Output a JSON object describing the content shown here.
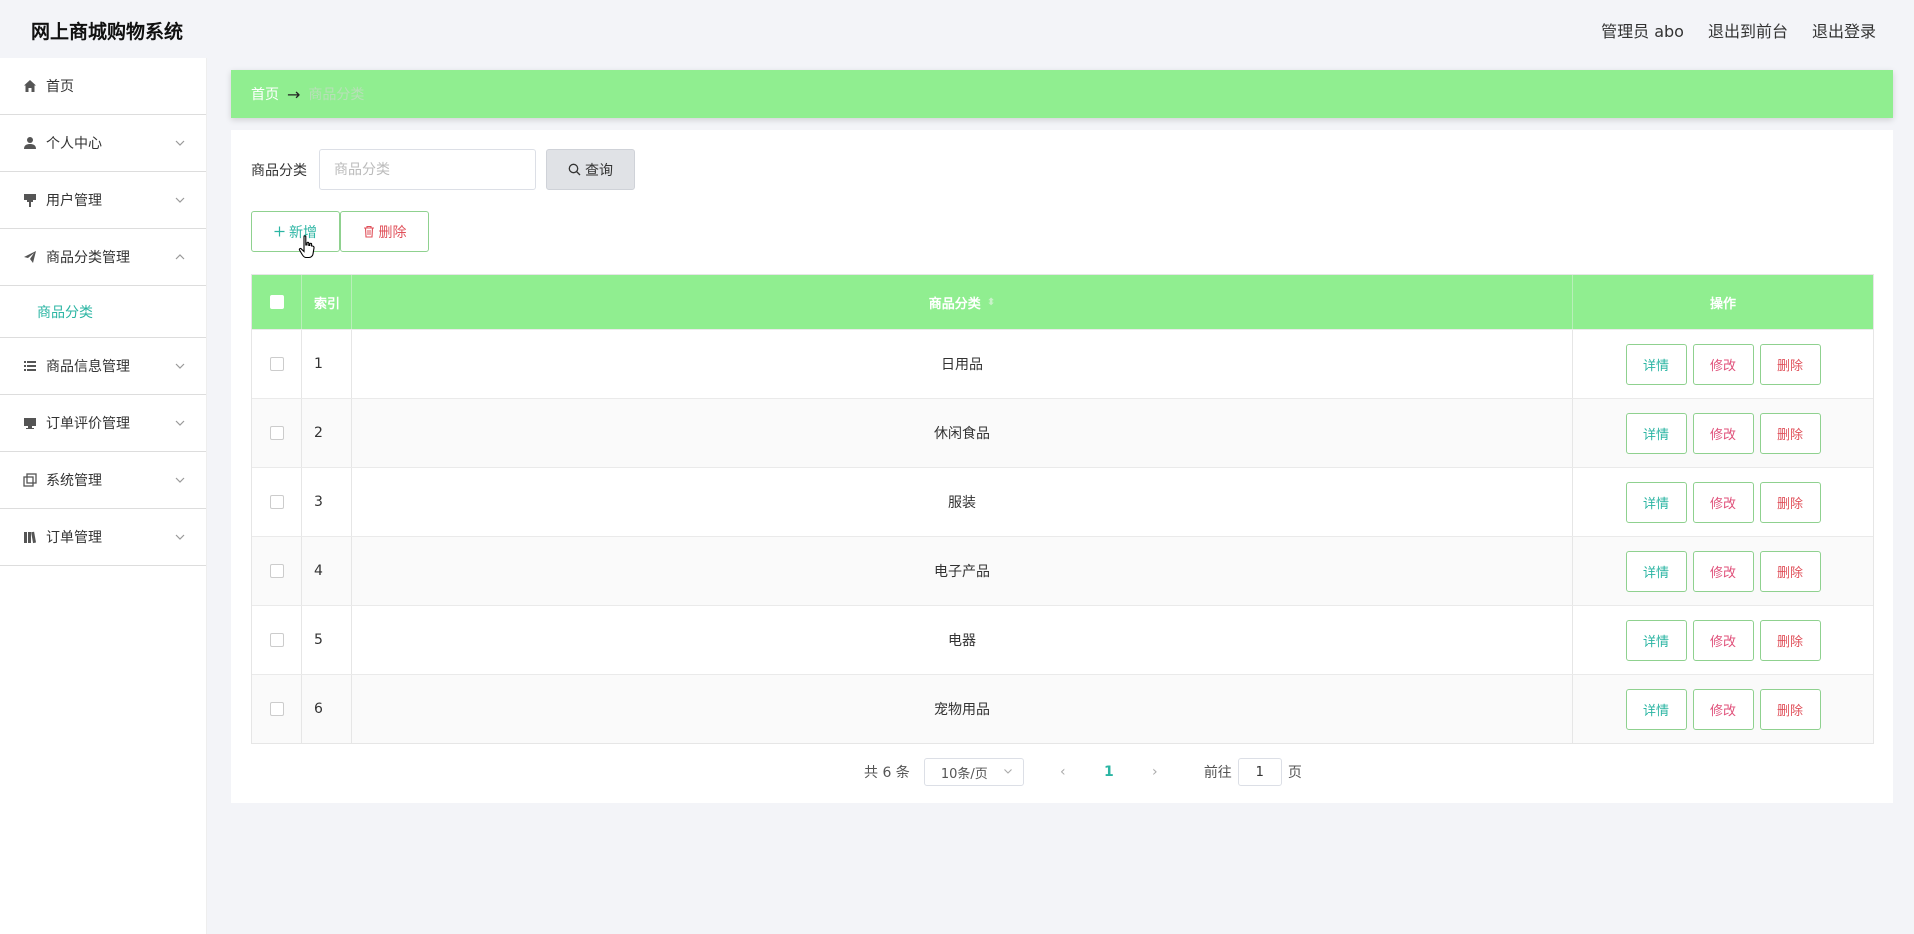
{
  "header": {
    "title": "网上商城购物系统",
    "admin_label": "管理员 abo",
    "to_front": "退出到前台",
    "logout": "退出登录"
  },
  "sidebar": {
    "items": [
      {
        "label": "首页",
        "icon": "home-icon"
      },
      {
        "label": "个人中心",
        "icon": "user-icon"
      },
      {
        "label": "用户管理",
        "icon": "brush-icon"
      },
      {
        "label": "商品分类管理",
        "icon": "paper-plane-icon"
      },
      {
        "label": "商品信息管理",
        "icon": "list-icon"
      },
      {
        "label": "订单评价管理",
        "icon": "monitor-icon"
      },
      {
        "label": "系统管理",
        "icon": "copy-icon"
      },
      {
        "label": "订单管理",
        "icon": "books-icon"
      }
    ],
    "submenu_active": "商品分类"
  },
  "breadcrumb": {
    "home": "首页",
    "separator": "→",
    "current": "商品分类"
  },
  "search": {
    "label": "商品分类",
    "placeholder": "商品分类",
    "button": "查询"
  },
  "actions": {
    "add": "新增",
    "delete": "删除"
  },
  "table": {
    "headers": {
      "index": "索引",
      "category": "商品分类",
      "ops": "操作"
    },
    "op_labels": {
      "detail": "详情",
      "edit": "修改",
      "delete": "删除"
    },
    "rows": [
      {
        "index": "1",
        "category": "日用品"
      },
      {
        "index": "2",
        "category": "休闲食品"
      },
      {
        "index": "3",
        "category": "服装"
      },
      {
        "index": "4",
        "category": "电子产品"
      },
      {
        "index": "5",
        "category": "电器"
      },
      {
        "index": "6",
        "category": "宠物用品"
      }
    ]
  },
  "pagination": {
    "total": "共 6 条",
    "page_size": "10条/页",
    "current_page": "1",
    "goto_prefix": "前往",
    "goto_value": "1",
    "goto_suffix": "页"
  },
  "colors": {
    "accent_green": "#90ee90",
    "teal": "#2bb5a3",
    "danger": "#e0505a"
  }
}
